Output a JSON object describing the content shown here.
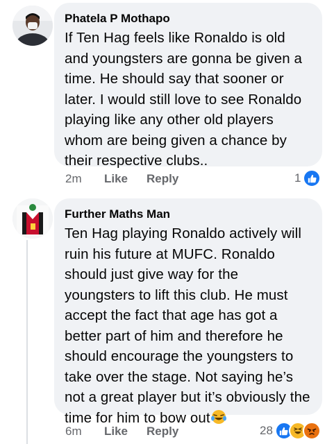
{
  "comments": [
    {
      "author": "Phatela P Mothapo",
      "text": "If Ten Hag feels like Ronaldo is old and youngsters are gonna be given a time. He should say that sooner or later. I would still love to see Ronaldo playing like any other old players whom are being given a chance by their respective clubs..",
      "time": "2m",
      "like_label": "Like",
      "reply_label": "Reply",
      "reaction_count": "1",
      "reactions": [
        "like-reaction-icon"
      ]
    },
    {
      "author": "Further Maths Man",
      "text": "Ten Hag playing Ronaldo actively will ruin his future at MUFC. Ronaldo should just give way for the youngsters to lift this club. He must accept the fact that age has got a better part of him and therefore he should encourage the youngsters to take over the stage. Not saying he’s not a great player but it’s obviously the time for him to bow out",
      "text_emoji": "crying-laughing-emoji",
      "time": "6m",
      "like_label": "Like",
      "reply_label": "Reply",
      "reaction_count": "28",
      "reactions": [
        "like-reaction-icon",
        "haha-reaction-icon",
        "angry-reaction-icon"
      ]
    }
  ],
  "colors": {
    "bubble": "#f0f2f5",
    "meta_text": "#65676b",
    "like_blue": "#1877f2",
    "haha_yellow": "#f7b928",
    "angry_orange": "#e9710f"
  }
}
